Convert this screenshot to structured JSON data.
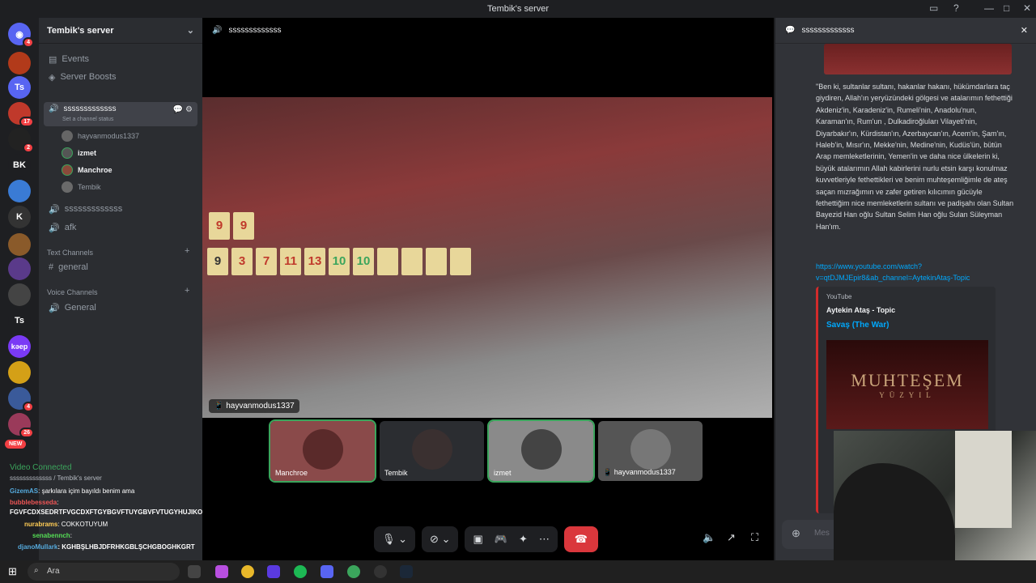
{
  "window": {
    "title": "Tembik's server"
  },
  "guilds": {
    "badges": [
      "4",
      "17",
      "2",
      "4",
      "26"
    ],
    "labels": [
      "Ts",
      "BK",
      "Ts",
      "kəep"
    ],
    "new_label": "NEW"
  },
  "sidebar": {
    "server_name": "Tembik's server",
    "items": [
      {
        "label": "Events"
      },
      {
        "label": "Server Boosts"
      }
    ],
    "active_channel": "sssssssssssss",
    "channel_status": "Set a channel status",
    "voice_users": [
      "hayvanmodus1337",
      "izmet",
      "Manchroe",
      "Tembik"
    ],
    "channels": [
      "sssssssssssss",
      "afk"
    ],
    "text_category": "Text Channels",
    "text_channel": "general",
    "voice_category": "Voice Channels",
    "voice_channel": "General"
  },
  "voice_panel": {
    "status": "Video Connected",
    "location": "sssssssssssss / Tembik's server"
  },
  "overlay_chat": [
    {
      "user": "GizemAS",
      "text": ": şarkılara içim bayıldı benim ama"
    },
    {
      "user": "bubblebesseda",
      "text": ":"
    },
    {
      "user": "",
      "text": "FGVFCDXSEDRTFVGCDXFTGYBGVFTUYGBVFVTUGYHUJIKOLŞÜ"
    },
    {
      "user": "nurabrams",
      "text": ": COKKOTUYUM"
    },
    {
      "user": "senabennch",
      "text": ":"
    },
    {
      "user": "djanoMullark",
      "text": ": KGHBŞLHBJDFRHKGBLŞCHGBOGHKGRT"
    }
  ],
  "main": {
    "channel": "sssssssssssss",
    "video_label": "hayvanmodus1337",
    "tiles": [
      "9",
      "9",
      "9",
      "3",
      "7",
      "11",
      "13",
      "10",
      "10"
    ],
    "participants": [
      "Manchroe",
      "Tembik",
      "izmet",
      "hayvanmodus1337"
    ]
  },
  "chat": {
    "channel": "sssssssssssss",
    "message": "\"Ben ki, sultanlar sultanı, hakanlar hakanı, hükümdarlara taç giydiren, Allah'ın yeryüzündeki gölgesi ve atalarımın fethettiği Akdeniz'in, Karadeniz'in, Rumeli'nin, Anadolu'nun, Karaman'ın, Rum'un , Dulkadiroğluları Vilayeti'nin, Diyarbakır'ın, Kürdistan'ın, Azerbaycan'ın, Acem'in, Şam'ın, Haleb'in, Mısır'ın, Mekke'nin, Medine'nin, Kudüs'ün, bütün Arap memleketlerinin, Yemen'in ve daha nice ülkelerin ki, büyük atalarımın Allah kabirlerini nurlu etsin karşı konulmaz kuvvetleriyle fethettikleri ve benim muhteşemliğimle de ateş saçan mızrağımın ve zafer getiren kılıcımın gücüyle fethettiğim nice memleketlerin sultanı ve padişahı olan Sultan Bayezid Han oğlu Sultan Selim Han oğlu Sulan Süleyman Han'ım.",
    "link": "https://www.youtube.com/watch?v=qtDJMJEpir8&ab_channel=AytekinAtaş-Topic",
    "embed": {
      "provider": "YouTube",
      "author": "Aytekin Ataş - Topic",
      "title": "Savaş (The War)",
      "thumb_title": "MUHTEŞEM",
      "thumb_sub": "YÜZYIL"
    },
    "input_placeholder": "Mes"
  },
  "taskbar": {
    "search_placeholder": "Ara"
  },
  "colors": {
    "accent": "#5865f2",
    "leave": "#da373c",
    "speaking": "#3ba55c"
  }
}
